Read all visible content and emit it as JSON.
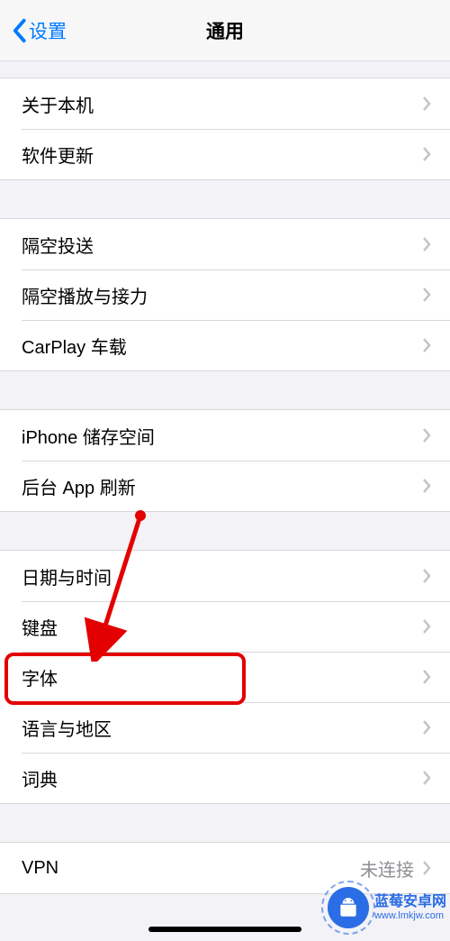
{
  "nav": {
    "back": "设置",
    "title": "通用"
  },
  "groups": [
    {
      "items": [
        {
          "id": "about",
          "label": "关于本机"
        },
        {
          "id": "software-update",
          "label": "软件更新"
        }
      ]
    },
    {
      "items": [
        {
          "id": "airdrop",
          "label": "隔空投送"
        },
        {
          "id": "airplay",
          "label": "隔空播放与接力"
        },
        {
          "id": "carplay",
          "label": "CarPlay 车载"
        }
      ]
    },
    {
      "items": [
        {
          "id": "storage",
          "label": "iPhone 储存空间"
        },
        {
          "id": "bg-refresh",
          "label": "后台 App 刷新"
        }
      ]
    },
    {
      "items": [
        {
          "id": "datetime",
          "label": "日期与时间"
        },
        {
          "id": "keyboard",
          "label": "键盘"
        },
        {
          "id": "fonts",
          "label": "字体"
        },
        {
          "id": "language",
          "label": "语言与地区"
        },
        {
          "id": "dictionary",
          "label": "词典"
        }
      ]
    },
    {
      "items": [
        {
          "id": "vpn",
          "label": "VPN",
          "value": "未连接"
        }
      ]
    }
  ],
  "watermark": {
    "title": "蓝莓安卓网",
    "url": "www.lmkjw.com"
  }
}
